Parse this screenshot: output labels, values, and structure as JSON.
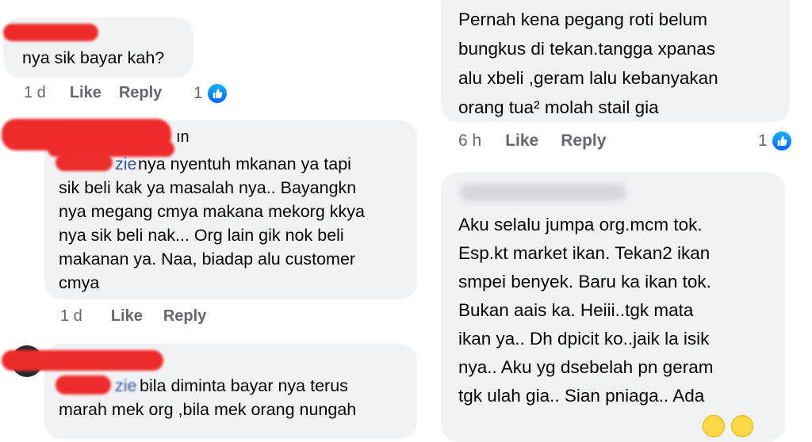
{
  "left": {
    "c1": {
      "text": "nya sik bayar kah?",
      "time": "1 d",
      "like": "Like",
      "reply": "Reply",
      "reactions": "1"
    },
    "c2": {
      "name_suffix": "ın",
      "mention_tail": "zie",
      "text": "nya nyentuh mkanan ya tapi\nsik beli kak ya masalah nya.. Bayangkn\nnya megang cmya makana mekorg kkya\nnya sik beli nak... Org lain gik nok beli\nmakanan ya.  Naa,  biadap alu customer\ncmya",
      "time": "1 d",
      "like": "Like",
      "reply": "Reply"
    },
    "c3": {
      "mention_tail": "zie",
      "text": "bila diminta bayar nya terus\nmarah mek org ,bila mek orang nungah"
    }
  },
  "right": {
    "c1": {
      "text": "Pernah kena pegang roti belum\nbungkus di tekan.tangga xpanas\nalu xbeli ,geram lalu kebanyakan\norang tua² molah stail gia",
      "time": "6 h",
      "like": "Like",
      "reply": "Reply",
      "reactions": "1"
    },
    "c2": {
      "text": "Aku selalu jumpa org.mcm tok.\nEsp.kt market ikan. Tekan2 ikan\nsmpei benyek. Baru ka ikan tok.\nBukan aais ka. Heiii..tgk mata\nikan ya.. Dh dpicit ko..jaik la isik\nnya.. Aku yg dsebelah pn geram\ntgk ulah gia.. Sian pniaga.. Ada"
    }
  },
  "icons": {
    "like": "thumbs-up-icon",
    "emoji": "grinning-emoji-icon"
  },
  "colors": {
    "bubble": "#f0f2f5",
    "meta": "#65676b",
    "redact": "#ee2b2b",
    "like_blue": "#0866ff"
  }
}
